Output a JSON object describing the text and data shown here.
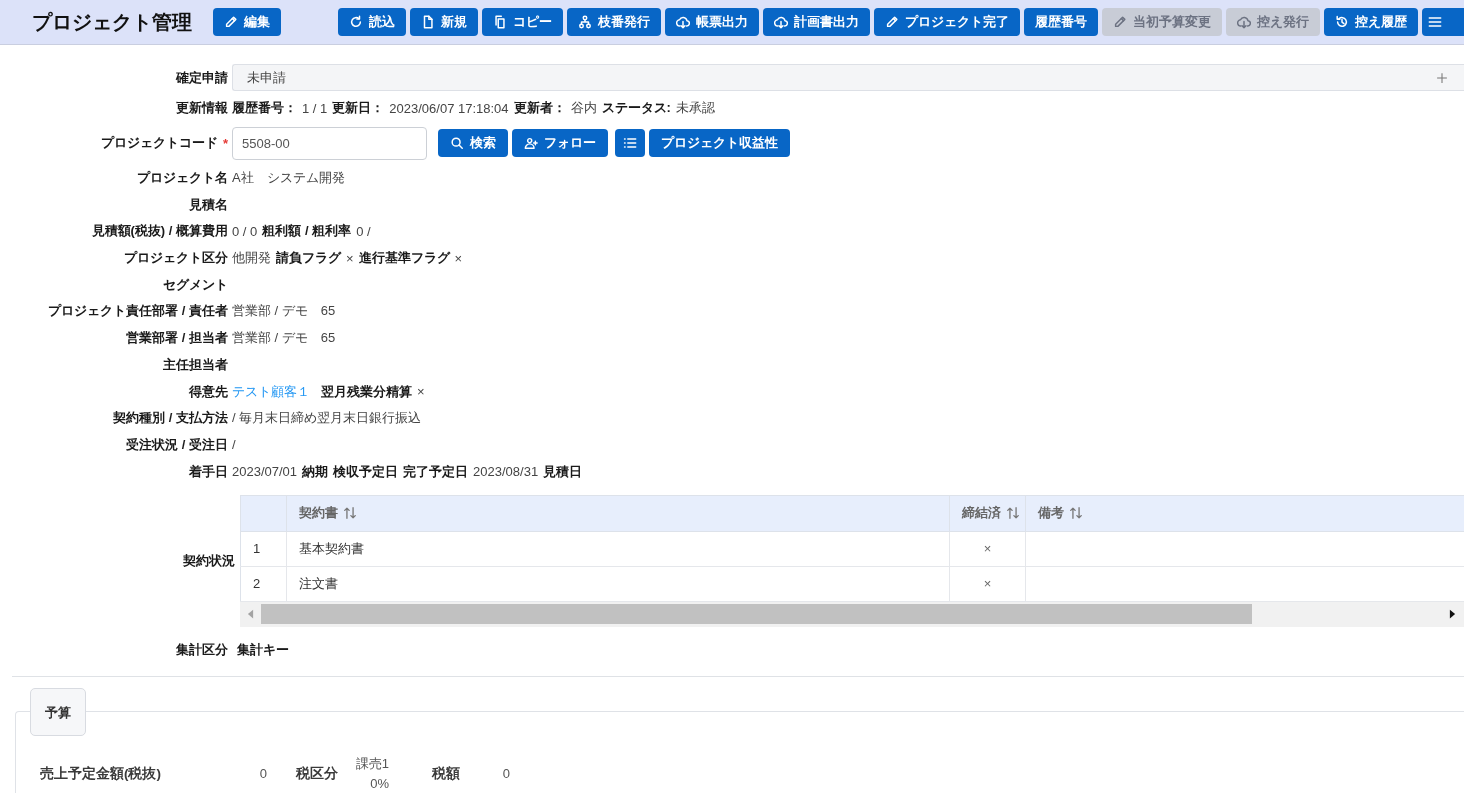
{
  "toolbar": {
    "title": "プロジェクト管理",
    "edit_button": {
      "label": "編集",
      "kind": "edit"
    },
    "buttons": [
      {
        "label": "読込",
        "kind": "reload",
        "disabled": false
      },
      {
        "label": "新規",
        "kind": "create",
        "disabled": false
      },
      {
        "label": "コピー",
        "kind": "copy",
        "disabled": false
      },
      {
        "label": "枝番発行",
        "kind": "branch",
        "disabled": false
      },
      {
        "label": "帳票出力",
        "kind": "export",
        "disabled": false
      },
      {
        "label": "計画書出力",
        "kind": "export",
        "disabled": false
      },
      {
        "label": "プロジェクト完了",
        "kind": "edit",
        "disabled": false
      },
      {
        "label": "履歴番号",
        "kind": "plain",
        "disabled": false
      },
      {
        "label": "当初予算変更",
        "kind": "edit",
        "disabled": true
      },
      {
        "label": "控え発行",
        "kind": "export",
        "disabled": true
      },
      {
        "label": "控え履歴",
        "kind": "history",
        "disabled": false
      },
      {
        "kind": "menu",
        "disabled": false
      }
    ]
  },
  "form": {
    "rows": [
      {
        "kind": "status",
        "label": "確定申請",
        "value": "未申請"
      },
      {
        "kind": "text",
        "label": "更新情報",
        "parts": [
          {
            "kind": "label",
            "text": "履歴番号："
          },
          {
            "kind": "value",
            "text": "1 / 1"
          },
          {
            "kind": "label",
            "text": "更新日："
          },
          {
            "kind": "value",
            "text": "2023/06/07 17:18:04"
          },
          {
            "kind": "label",
            "text": "更新者："
          },
          {
            "kind": "value",
            "text": "谷内"
          },
          {
            "kind": "label",
            "text": "ステータス:"
          },
          {
            "kind": "value",
            "text": "未承認"
          }
        ]
      },
      {
        "kind": "code",
        "label": "プロジェクトコード",
        "required_mark": "*",
        "value": "5508-00",
        "buttons": [
          {
            "label": "検索",
            "kind": "search"
          },
          {
            "label": "フォロー",
            "kind": "follow"
          },
          {
            "kind": "list"
          },
          {
            "label": "プロジェクト収益性",
            "kind": "plain"
          }
        ]
      },
      {
        "kind": "text",
        "label": "プロジェクト名",
        "parts": [
          {
            "kind": "value",
            "text": "A社　システム開発"
          }
        ]
      },
      {
        "kind": "text",
        "label": "見積名"
      },
      {
        "kind": "text",
        "label": "見積額(税抜) / 概算費用",
        "parts": [
          {
            "kind": "value",
            "text": "0 / 0"
          },
          {
            "kind": "label",
            "text": "粗利額 / 粗利率"
          },
          {
            "kind": "value",
            "text": "0 /"
          }
        ]
      },
      {
        "kind": "text",
        "label": "プロジェクト区分",
        "parts": [
          {
            "kind": "value",
            "text": "他開発"
          },
          {
            "kind": "label",
            "text": "請負フラグ"
          },
          {
            "kind": "value",
            "text": "×"
          },
          {
            "kind": "label",
            "text": "進行基準フラグ"
          },
          {
            "kind": "value",
            "text": "×"
          }
        ]
      },
      {
        "kind": "text",
        "label": "セグメント"
      },
      {
        "kind": "text",
        "label": "プロジェクト責任部署 / 責任者",
        "parts": [
          {
            "kind": "value",
            "text": "営業部 / デモ　65"
          }
        ]
      },
      {
        "kind": "text",
        "label": "営業部署 / 担当者",
        "parts": [
          {
            "kind": "value",
            "text": "営業部 / デモ　65"
          }
        ]
      },
      {
        "kind": "text",
        "label": "主任担当者"
      },
      {
        "kind": "text",
        "label": "得意先",
        "parts": [
          {
            "kind": "link",
            "text": "テスト顧客１"
          },
          {
            "kind": "label",
            "text": "翌月残業分精算"
          },
          {
            "kind": "value",
            "text": "×"
          }
        ]
      },
      {
        "kind": "text",
        "label": "契約種別 / 支払方法",
        "parts": [
          {
            "kind": "value",
            "text": "/ 毎月末日締め翌月末日銀行振込"
          }
        ]
      },
      {
        "kind": "text",
        "label": "受注状況 / 受注日",
        "parts": [
          {
            "kind": "value",
            "text": "/"
          }
        ]
      },
      {
        "kind": "text",
        "label": "着手日",
        "parts": [
          {
            "kind": "value",
            "text": "2023/07/01"
          },
          {
            "kind": "label",
            "text": "納期"
          },
          {
            "kind": "label",
            "text": "検収予定日"
          },
          {
            "kind": "label",
            "text": "完了予定日"
          },
          {
            "kind": "value",
            "text": "2023/08/31"
          },
          {
            "kind": "label",
            "text": "見積日"
          }
        ]
      },
      {
        "kind": "table",
        "label": "契約状況",
        "table": {
          "columns": [
            {
              "label": "契約書",
              "sortable": true
            },
            {
              "label": "締結済",
              "sortable": true
            },
            {
              "label": "備考",
              "sortable": true
            }
          ],
          "rows": [
            {
              "number": "1",
              "document": "基本契約書",
              "concluded": "×"
            },
            {
              "number": "2",
              "document": "注文書",
              "concluded": "×"
            }
          ]
        }
      },
      {
        "kind": "text",
        "label": "集計区分",
        "parts": [
          {
            "kind": "label",
            "text": "集計キー"
          }
        ]
      }
    ]
  },
  "budget": {
    "legend": "予算",
    "items": [
      {
        "label": "売上予定金額(税抜)",
        "value": "0"
      },
      {
        "label": "税区分",
        "value_lines": [
          "課売1",
          "0%"
        ]
      },
      {
        "label": "税額",
        "value": "0"
      }
    ]
  }
}
